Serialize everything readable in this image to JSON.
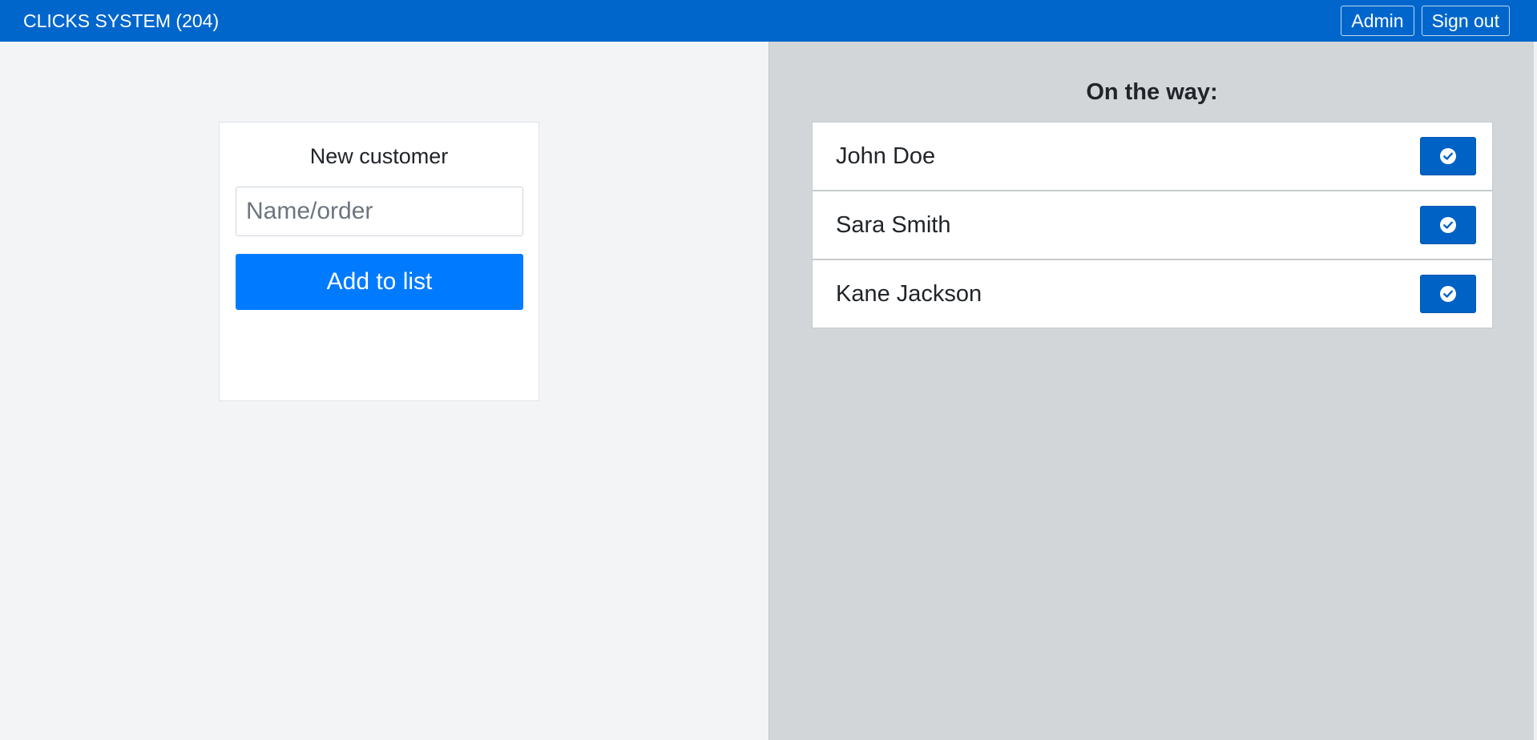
{
  "header": {
    "brand": "CLICKS SYSTEM (204)",
    "admin_label": "Admin",
    "signout_label": "Sign out",
    "color": "#0066cc"
  },
  "new_customer": {
    "title": "New customer",
    "input_value": "",
    "input_placeholder": "Name/order",
    "add_label": "Add to list",
    "button_color": "#007bff"
  },
  "on_the_way": {
    "heading": "On the way:",
    "items": [
      {
        "name": "John Doe",
        "action_icon": "check-circle-icon"
      },
      {
        "name": "Sara Smith",
        "action_icon": "check-circle-icon"
      },
      {
        "name": "Kane Jackson",
        "action_icon": "check-circle-icon"
      }
    ]
  }
}
